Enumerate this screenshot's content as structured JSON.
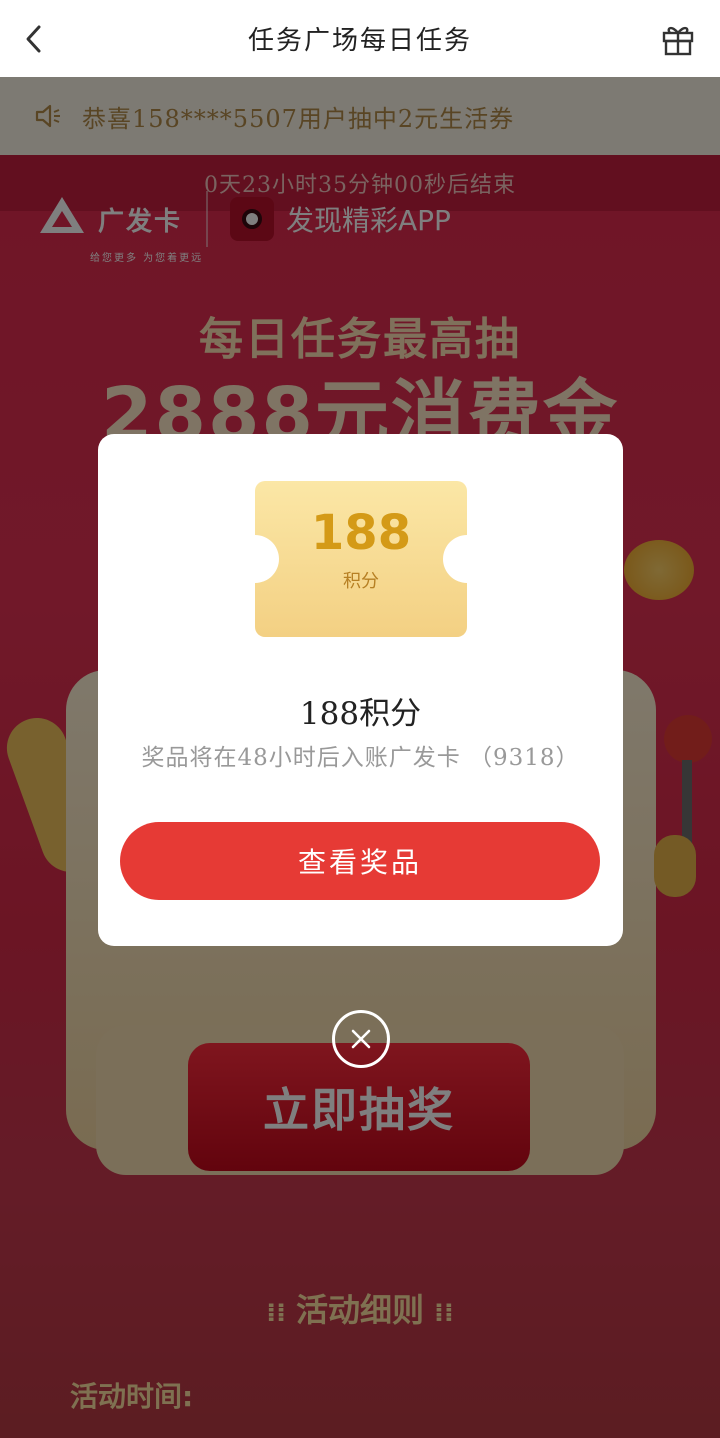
{
  "navbar": {
    "title": "任务广场每日任务",
    "back_icon": "chevron-left-icon",
    "gift_icon": "gift-icon"
  },
  "marquee": {
    "icon": "speaker-icon",
    "text": "恭喜158****5507用户抽中2元生活券"
  },
  "promo": {
    "countdown": "0天23小时35分钟00秒后结束",
    "brand_name": "广发卡",
    "brand_slogan": "给您更多  为您着更远",
    "partner_app": "发现精彩APP",
    "headline": "每日任务最高抽",
    "headline_big": "2888元消费金",
    "draw_button": "立即抽奖",
    "rules_heading": "活动细则",
    "rules_dots_left": "⁞⁞",
    "rules_dots_right": "⁞⁞",
    "activity_time_label": "活动时间:"
  },
  "modal": {
    "ticket_value": "188",
    "ticket_unit": "积分",
    "prize_name": "188积分",
    "prize_note": "奖品将在48小时后入账广发卡 （9318）",
    "view_button": "查看奖品",
    "close_icon": "close-icon"
  },
  "colors": {
    "accent_red": "#e63a35",
    "promo_red": "#e02a4e",
    "ticket_gold": "#d49a17",
    "marquee_text": "#b28a49"
  }
}
